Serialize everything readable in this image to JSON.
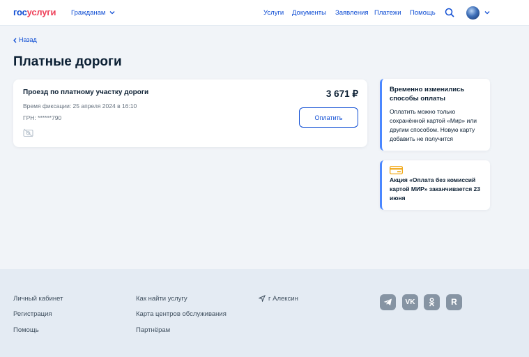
{
  "header": {
    "logo_part1": "гос",
    "logo_part2": "услуги",
    "region_label": "Гражданам",
    "nav": [
      "Услуги",
      "Документы",
      "Заявления",
      "Платежи",
      "Помощь"
    ]
  },
  "main": {
    "back_label": "Назад",
    "page_title": "Платные дороги"
  },
  "payment_card": {
    "title": "Проезд по платному участку дороги",
    "time": "Время фиксации: 25 апреля 2024 в 16:10",
    "grn": "ГРН: ******790",
    "amount": "3 671 ₽",
    "pay_label": "Оплатить"
  },
  "notices": {
    "n1_title": "Временно изменились способы оплаты",
    "n1_text": "Оплатить можно только сохранённой картой «Мир» или другим способом. Новую карту добавить не получится",
    "n2_text": "Акция «Оплата без комиссий картой МИР» заканчивается 23 июня"
  },
  "footer": {
    "col1": [
      "Личный кабинет",
      "Регистрация",
      "Помощь"
    ],
    "col2": [
      "Как найти услугу",
      "Карта центров обслуживания",
      "Партнёрам"
    ],
    "location": "г Алексин",
    "socials": [
      "telegram-icon",
      "vk-icon",
      "odnoklassniki-icon",
      "rutube-icon"
    ]
  },
  "colors": {
    "accent": "#0d4cd3",
    "logo_red": "#ee3f58",
    "notice_border": "#4b87ff",
    "footer_bg": "#e4ebf3"
  }
}
